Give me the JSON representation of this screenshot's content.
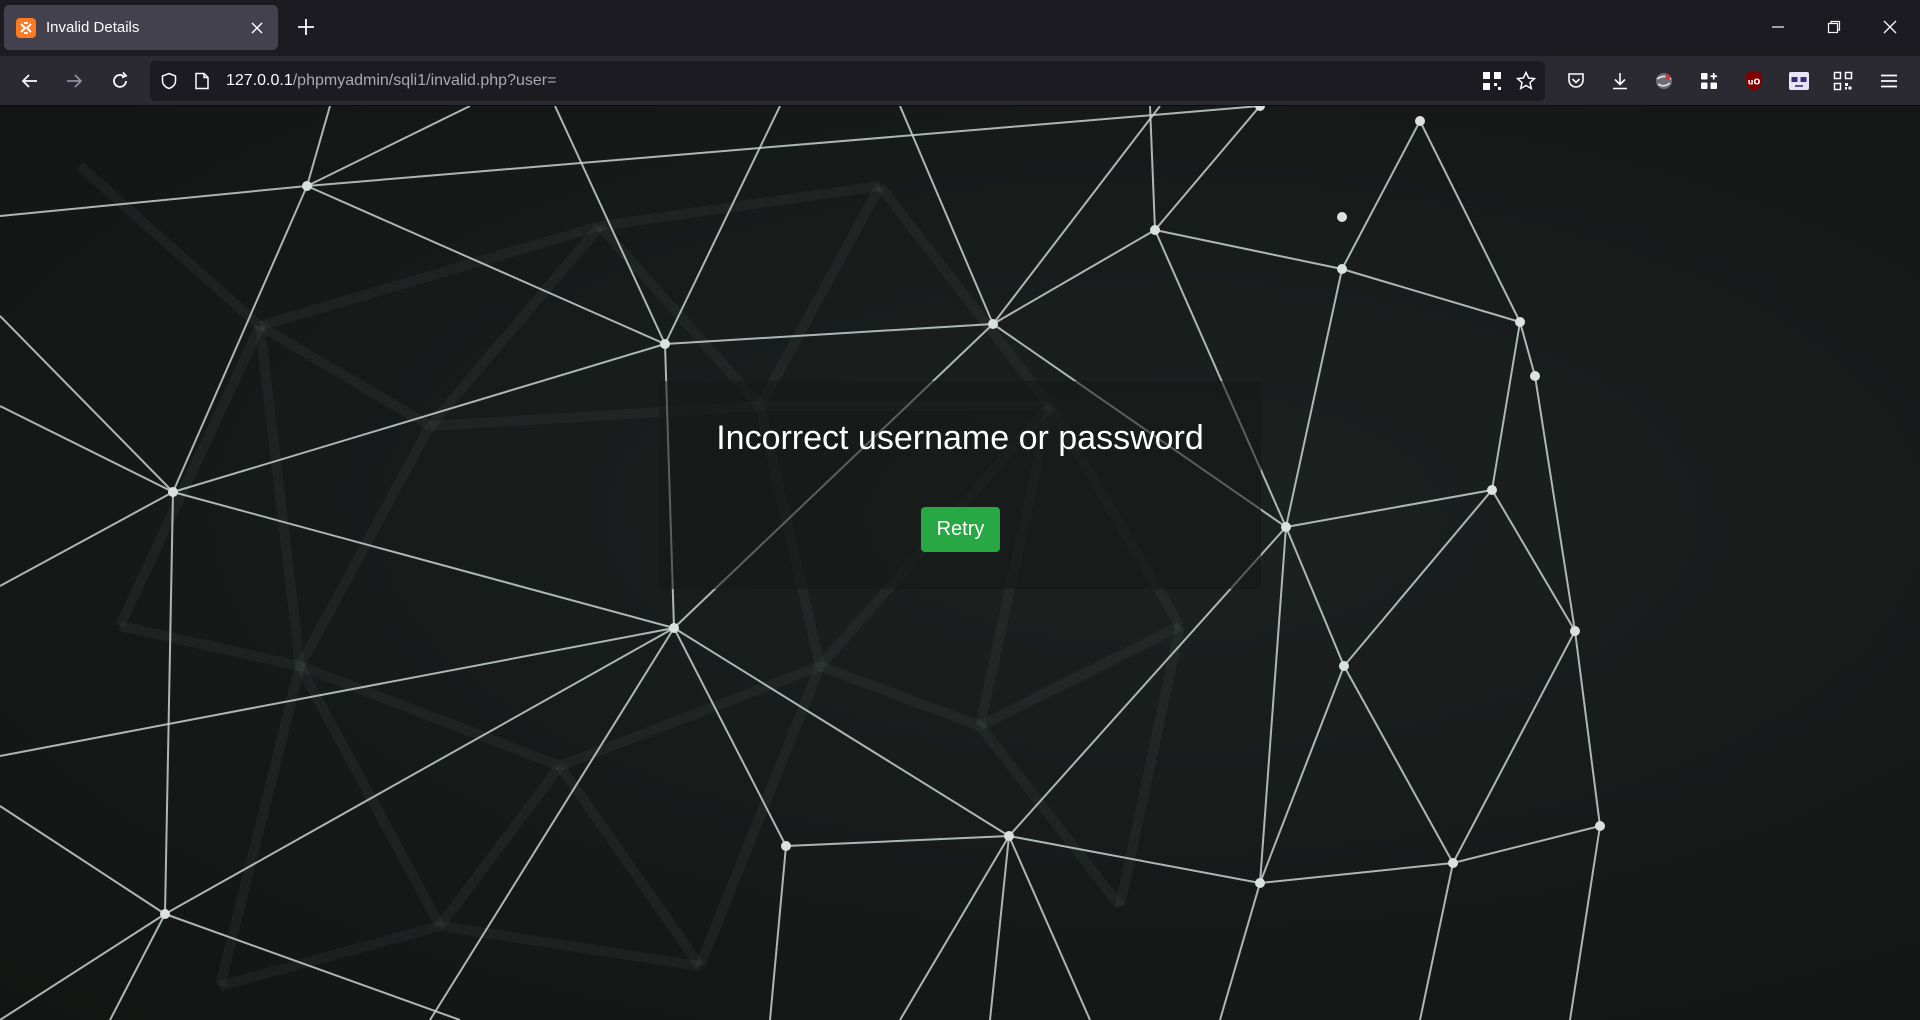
{
  "browser": {
    "tab": {
      "title": "Invalid Details",
      "favicon": "xampp-icon"
    },
    "url": {
      "host": "127.0.0.1",
      "path": "/phpmyadmin/sqli1/invalid.php?user="
    }
  },
  "page": {
    "message": "Incorrect username or password",
    "retry_label": "Retry"
  },
  "colors": {
    "button_bg": "#28a745",
    "page_bg": "#161918",
    "mesh_line": "#c8d2cf"
  }
}
